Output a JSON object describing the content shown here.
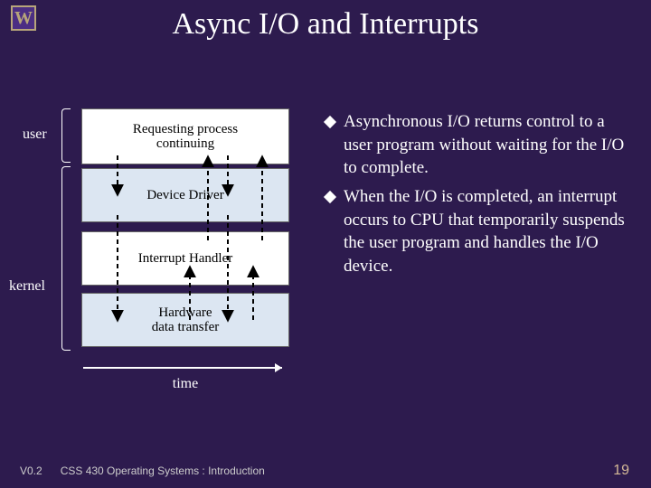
{
  "logo": "W",
  "title": "Async I/O and Interrupts",
  "diagram": {
    "labels": {
      "user": "user",
      "kernel": "kernel"
    },
    "boxes": [
      {
        "label": "Requesting process\ncontinuing"
      },
      {
        "label": "Device Driver"
      },
      {
        "label": "Interrupt Handler"
      },
      {
        "label": "Hardware\ndata transfer"
      }
    ],
    "time": "time"
  },
  "bullets": [
    "Asynchronous I/O returns control to a user program without waiting for the I/O to complete.",
    "When the I/O is completed, an interrupt occurs to CPU that temporarily suspends the user program and handles the I/O device."
  ],
  "footer": {
    "version": "V0.2",
    "course": "CSS 430 Operating Systems : Introduction",
    "page": "19"
  }
}
